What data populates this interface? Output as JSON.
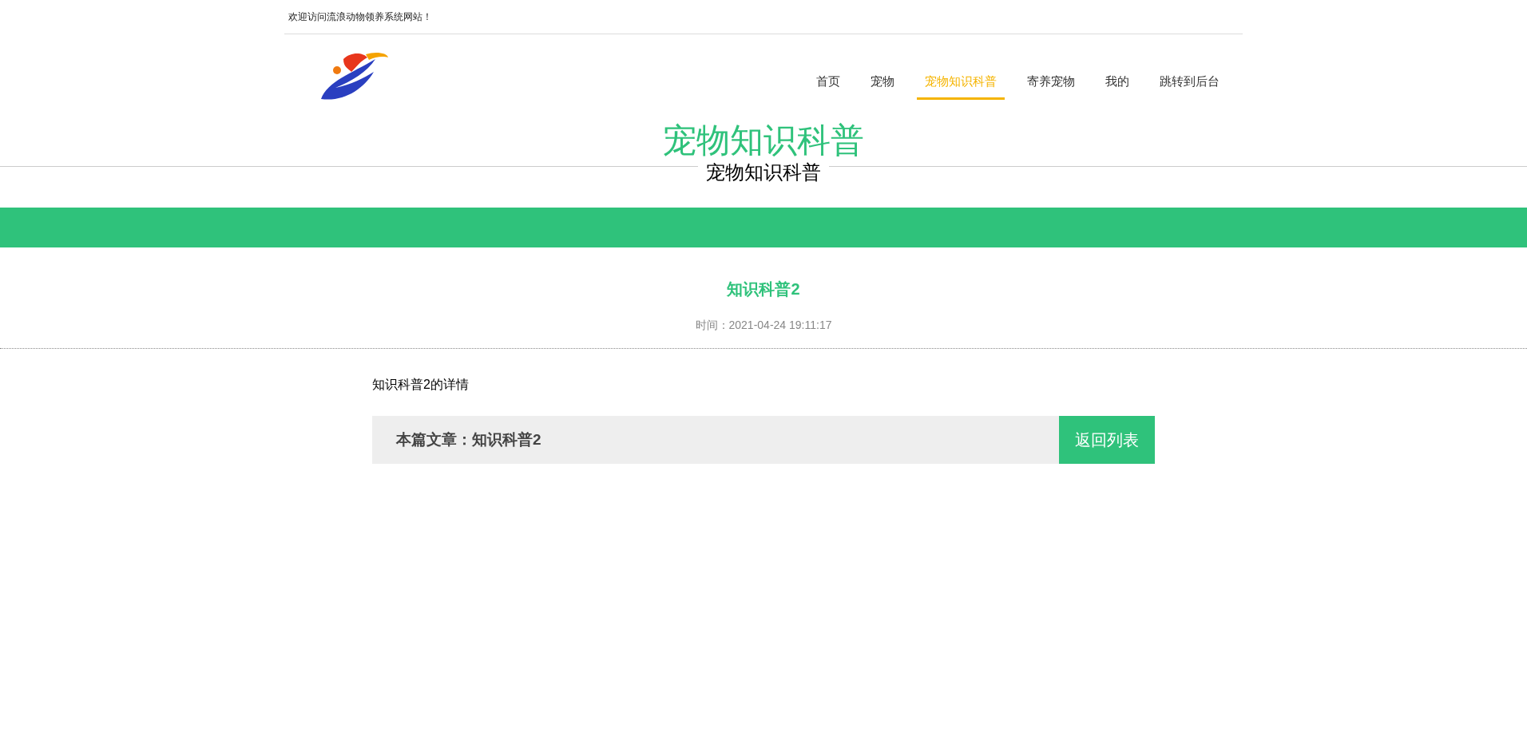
{
  "top_bar": {
    "welcome": "欢迎访问流浪动物领养系统网站！"
  },
  "nav": [
    {
      "label": "首页",
      "selected": false
    },
    {
      "label": "宠物",
      "selected": false
    },
    {
      "label": "宠物知识科普",
      "selected": true
    },
    {
      "label": "寄养宠物",
      "selected": false
    },
    {
      "label": "我的",
      "selected": false
    },
    {
      "label": "跳转到后台",
      "selected": false
    }
  ],
  "page_title": "宠物知识科普",
  "page_subtitle": "宠物知识科普",
  "article": {
    "title": "知识科普2",
    "time": "时间：2021-04-24 19:11:17",
    "body": "知识科普2的详情",
    "footer_label": "本篇文章：知识科普2",
    "back_button": "返回列表"
  }
}
